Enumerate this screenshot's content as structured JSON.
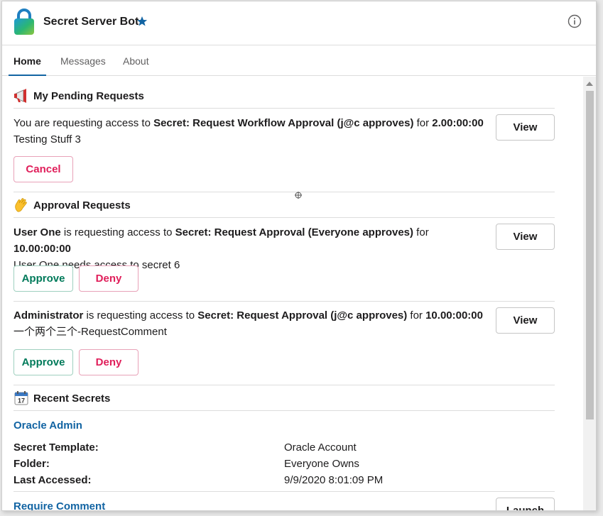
{
  "app": {
    "title": "Secret Server Bot"
  },
  "tabs": [
    {
      "label": "Home"
    },
    {
      "label": "Messages"
    },
    {
      "label": "About"
    }
  ],
  "pending": {
    "title": "My Pending Requests",
    "request": {
      "prefix": "You are requesting access to ",
      "secret": "Secret: Request Workflow Approval (j@c approves)",
      "for": " for ",
      "duration": "2.00:00:00",
      "comment": "Testing Stuff 3"
    },
    "view_label": "View",
    "cancel_label": "Cancel"
  },
  "approvals": {
    "title": "Approval Requests",
    "items": [
      {
        "user": "User One",
        "mid": " is requesting access to ",
        "secret": "Secret: Request Approval (Everyone approves)",
        "for": " for ",
        "duration": "10.00:00:00",
        "comment": "User One needs access to secret 6",
        "view_label": "View",
        "approve_label": "Approve",
        "deny_label": "Deny"
      },
      {
        "user": "Administrator",
        "mid": " is requesting access to ",
        "secret": "Secret: Request Approval (j@c approves)",
        "for": " for ",
        "duration": "10.00:00:00",
        "comment": "一个两个三个-RequestComment",
        "view_label": "View",
        "approve_label": "Approve",
        "deny_label": "Deny"
      }
    ]
  },
  "recent": {
    "title": "Recent Secrets",
    "secrets": [
      {
        "name": "Oracle Admin",
        "fields": [
          {
            "label": "Secret Template:",
            "value": "Oracle Account"
          },
          {
            "label": "Folder:",
            "value": "Everyone Owns"
          },
          {
            "label": "Last Accessed:",
            "value": "9/9/2020 8:01:09 PM"
          }
        ]
      },
      {
        "name": "Require Comment",
        "launch_label": "Launch"
      }
    ]
  },
  "colors": {
    "link": "#1264a3",
    "approve": "#007a5a",
    "danger": "#e01e5a",
    "star": "#1264a3"
  },
  "icons": {
    "app": "lock-icon",
    "star": "star-icon",
    "info": "info-icon",
    "pending": "megaphone-icon",
    "approval": "waving-hand-icon",
    "recent": "calendar-icon"
  }
}
